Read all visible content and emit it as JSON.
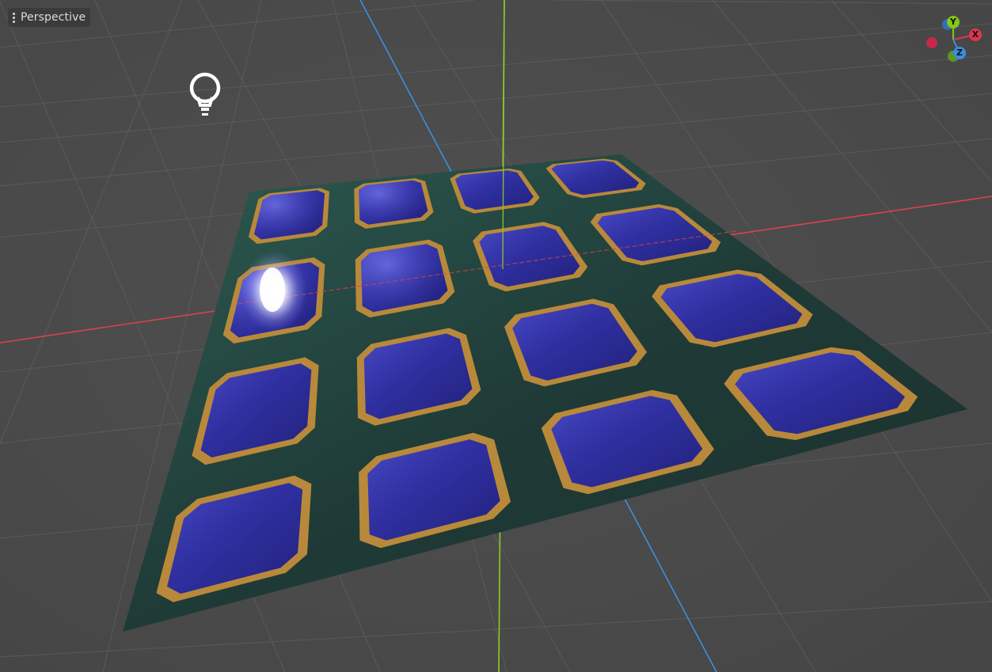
{
  "viewport": {
    "view_menu_label": "Perspective"
  },
  "gizmo": {
    "x_label": "X",
    "y_label": "Y",
    "z_label": "Z",
    "colors": {
      "x": "#e0354e",
      "y": "#84c61a",
      "z": "#3a8fe0"
    }
  },
  "scene": {
    "axis_colors": {
      "x": "#d9434b",
      "y": "#8ccc2a",
      "z": "#3b8fe0"
    },
    "board": {
      "rows": 4,
      "cols": 4,
      "base_color": "#1f3a36",
      "tile_color": "#2a2a92",
      "tile_border_color": "#b8893a"
    }
  }
}
